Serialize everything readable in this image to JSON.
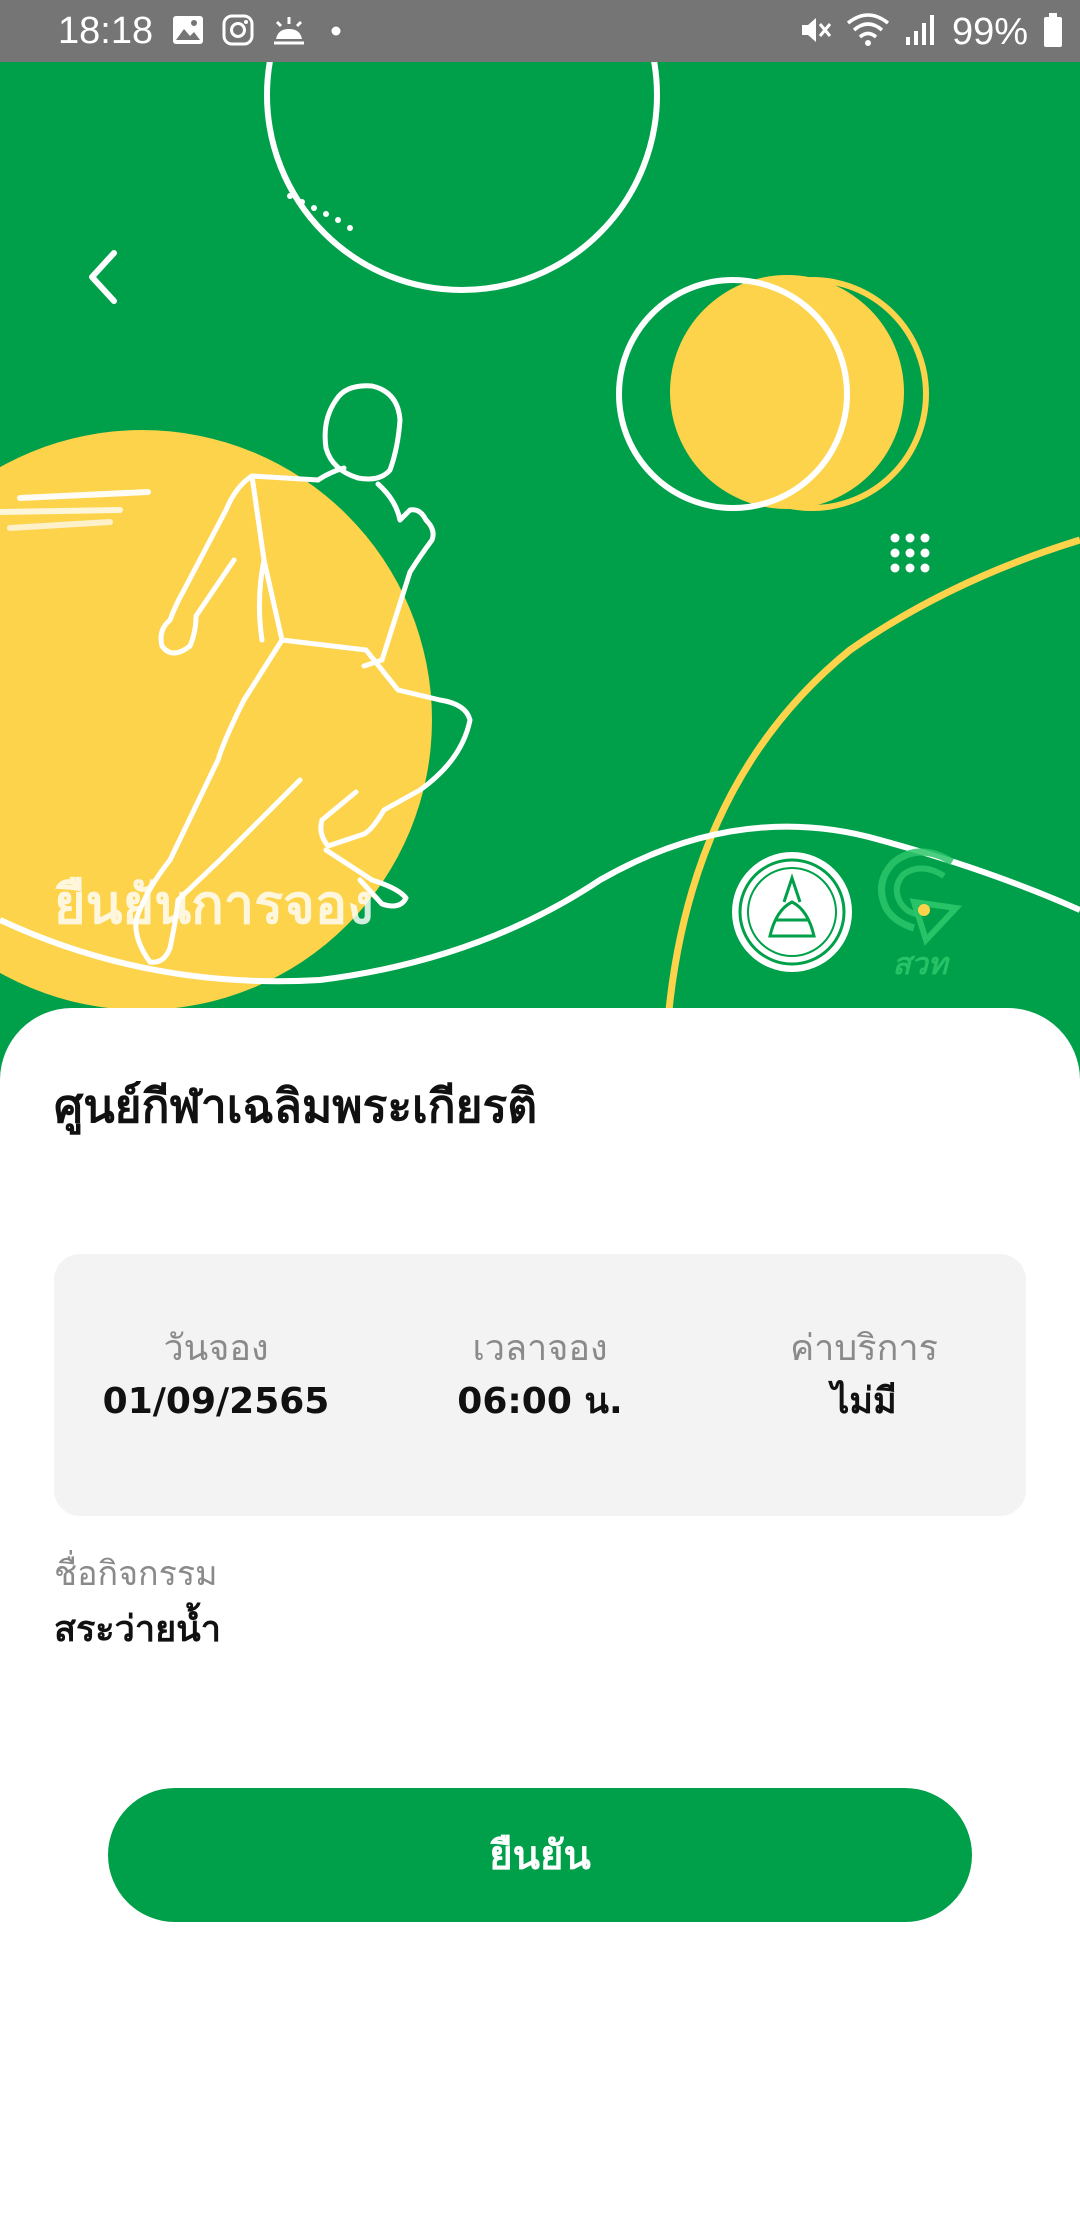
{
  "status_bar": {
    "time": "18:18",
    "battery": "99%",
    "background_color": "#757575",
    "left_icons": [
      "gallery-icon",
      "instagram-icon",
      "weather-icon",
      "dot-icon"
    ],
    "right_icons": [
      "mute-icon",
      "wifi-icon",
      "signal-icon",
      "battery-icon"
    ]
  },
  "header": {
    "back_icon": "chevron-left-icon",
    "title": "ยืนยันการจอง",
    "logos": [
      "bangkok-seal-logo",
      "sport-center-logo"
    ],
    "logo_text": "สวท"
  },
  "venue": {
    "name": "ศูนย์กีฬาเฉลิมพระเกียรติ"
  },
  "booking": {
    "date_label": "วันจอง",
    "date_value": "01/09/2565",
    "time_label": "เวลาจอง",
    "time_value": "06:00 น.",
    "fee_label": "ค่าบริการ",
    "fee_value": "ไม่มี"
  },
  "activity": {
    "label": "ชื่อกิจกรรม",
    "value": "สระว่ายน้ำ"
  },
  "confirm_button": {
    "label": "ยืนยัน"
  },
  "colors": {
    "primary_green": "#00a04a",
    "accent_yellow": "#fcd34a",
    "card_bg": "#f3f3f3"
  }
}
